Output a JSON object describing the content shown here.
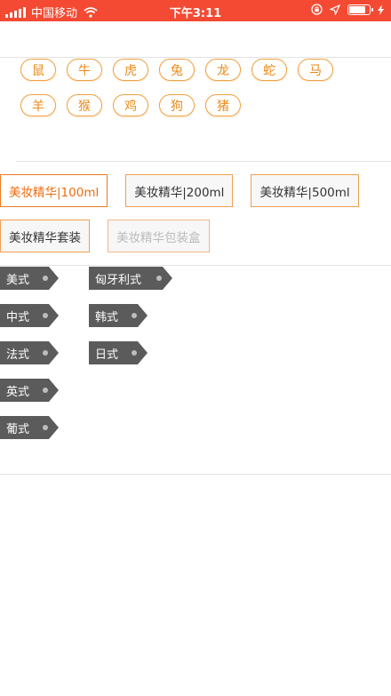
{
  "status_bar": {
    "carrier": "中国移动",
    "time": "下午3:11",
    "battery_level": 0.9
  },
  "zodiac": {
    "rows": [
      [
        "鼠",
        "牛",
        "虎",
        "兔",
        "龙",
        "蛇",
        "马"
      ],
      [
        "羊",
        "猴",
        "鸡",
        "狗",
        "猪"
      ]
    ],
    "accent_color": "#ec8a18"
  },
  "options": {
    "rows": [
      [
        {
          "label": "美妆精华|100ml",
          "state": "selected"
        },
        {
          "label": "美妆精华|200ml",
          "state": "normal"
        },
        {
          "label": "美妆精华|500ml",
          "state": "normal"
        }
      ],
      [
        {
          "label": "美妆精华套装",
          "state": "normal"
        },
        {
          "label": "美妆精华包装盒",
          "state": "disabled"
        }
      ]
    ],
    "selected_color": "#ec6d10"
  },
  "styles": {
    "col1": [
      "美式",
      "中式",
      "法式",
      "英式",
      "葡式"
    ],
    "col2": [
      "匈牙利式",
      "韩式",
      "日式"
    ],
    "tag_color": "#5b5b5b"
  }
}
